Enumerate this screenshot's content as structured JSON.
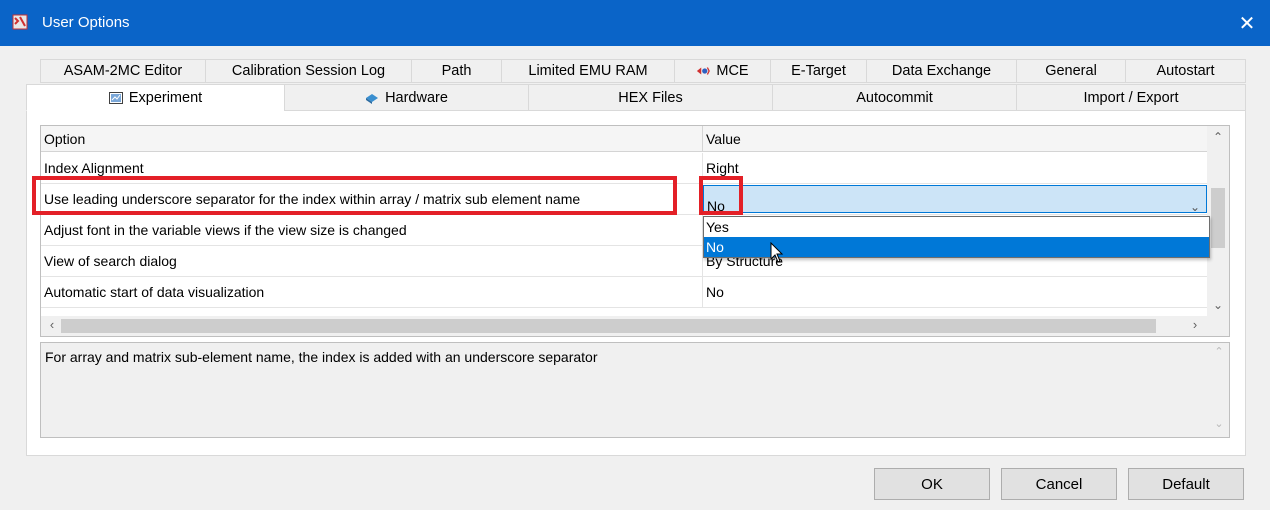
{
  "window": {
    "title": "User Options",
    "close_glyph": "✕"
  },
  "tabs_row1": [
    {
      "label": "ASAM-2MC Editor",
      "icon": null
    },
    {
      "label": "Calibration Session Log",
      "icon": null
    },
    {
      "label": "Path",
      "icon": null
    },
    {
      "label": "Limited EMU RAM",
      "icon": null
    },
    {
      "label": "MCE",
      "icon": "mce-icon"
    },
    {
      "label": "E-Target",
      "icon": null
    },
    {
      "label": "Data Exchange",
      "icon": null
    },
    {
      "label": "General",
      "icon": null
    },
    {
      "label": "Autostart",
      "icon": null
    }
  ],
  "tabs_row2": [
    {
      "label": "Experiment",
      "icon": "experiment-icon",
      "active": true
    },
    {
      "label": "Hardware",
      "icon": "hardware-icon"
    },
    {
      "label": "HEX Files",
      "icon": null
    },
    {
      "label": "Autocommit",
      "icon": null
    },
    {
      "label": "Import / Export",
      "icon": null
    }
  ],
  "grid": {
    "columns": [
      "Option",
      "Value"
    ],
    "rows": [
      {
        "option": "Index Alignment",
        "value": "Right"
      },
      {
        "option": "Use leading underscore separator for the index within array / matrix sub element name",
        "value": "No"
      },
      {
        "option": "Adjust font in the variable views if the view size is changed",
        "value": ""
      },
      {
        "option": "View of search dialog",
        "value": "By Structure"
      },
      {
        "option": "Automatic start of data visualization",
        "value": "No"
      }
    ],
    "dropdown_options": [
      "Yes",
      "No"
    ],
    "dropdown_selected": "No"
  },
  "description": "For array and matrix sub-element name, the index is added with an underscore separator",
  "buttons": {
    "ok": "OK",
    "cancel": "Cancel",
    "default": "Default"
  },
  "colors": {
    "titlebar": "#0a64c8",
    "highlight": "#e32027",
    "selection": "#0078d7",
    "dropdown_bg": "#cce4f7"
  }
}
